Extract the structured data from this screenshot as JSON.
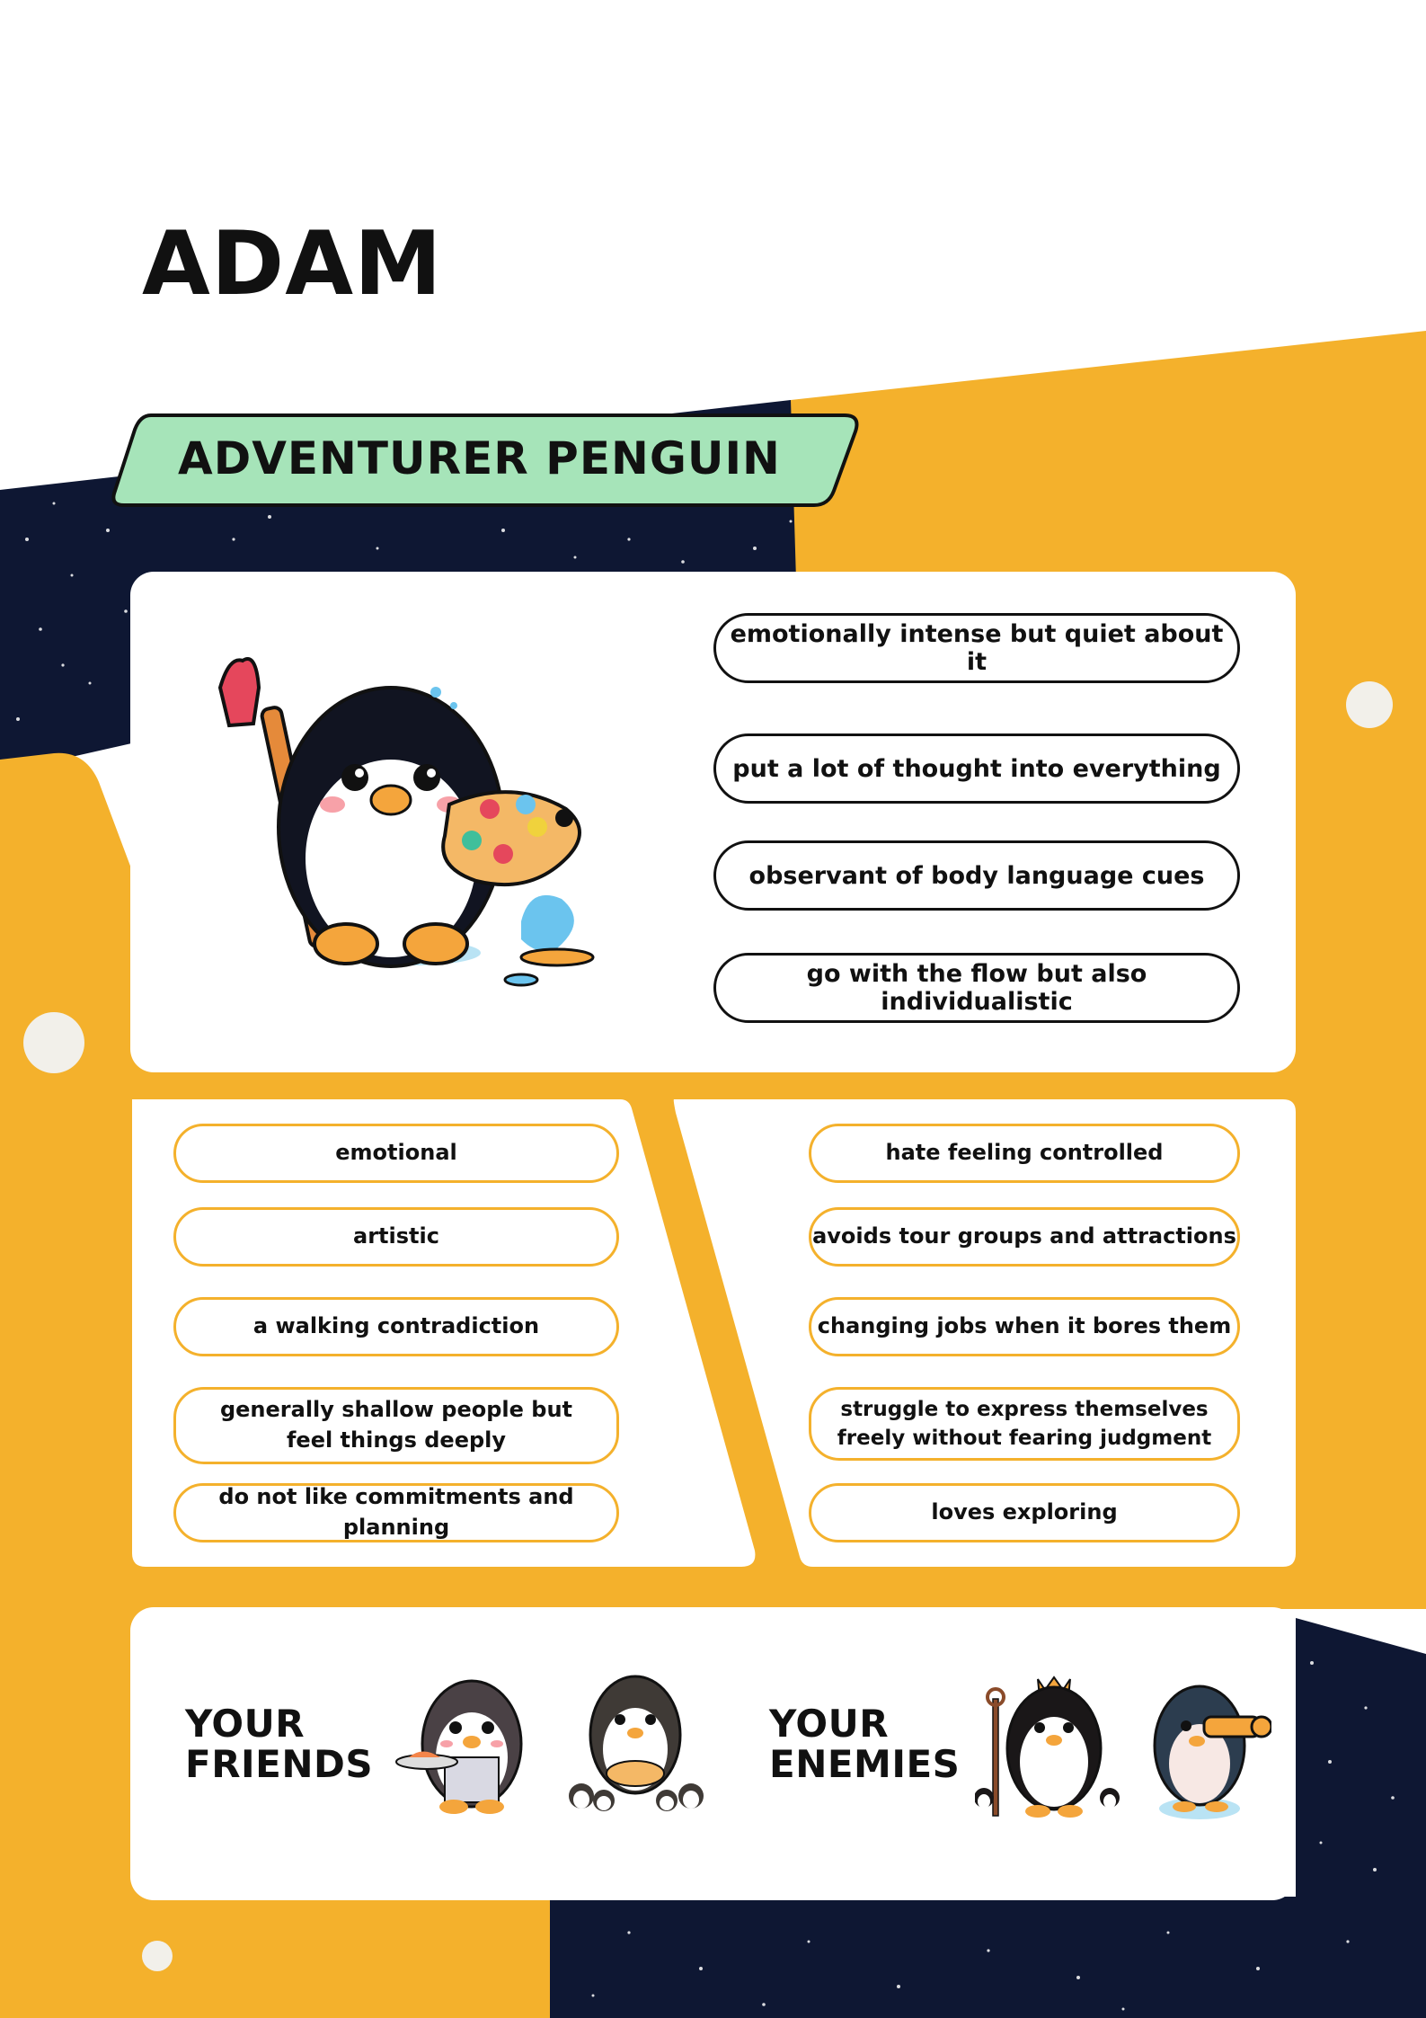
{
  "profile": {
    "name": "ADAM",
    "title": "ADVENTURER PENGUIN"
  },
  "colors": {
    "accent_yellow": "#f4b12c",
    "navy": "#0e1733",
    "banner_green": "#a6e4b9",
    "card_white": "#ffffff"
  },
  "main_traits": [
    "emotionally intense but quiet about it",
    "put a lot of thought into everything",
    "observant of body language cues",
    "go with the flow but also individualistic"
  ],
  "left_traits": [
    "emotional",
    "artistic",
    "a walking contradiction",
    "generally shallow people but feel things deeply",
    "do not like commitments and planning"
  ],
  "right_traits": [
    "hate feeling controlled",
    "avoids tour groups and attractions",
    "changing jobs when it bores them",
    "struggle to express themselves freely without fearing judgment",
    "loves exploring"
  ],
  "relations": {
    "friends_line1": "YOUR",
    "friends_line2": "FRIENDS",
    "enemies_line1": "YOUR",
    "enemies_line2": "ENEMIES"
  },
  "icons": {
    "hero": "artist-penguin-icon",
    "friend_1": "chef-penguin-icon",
    "friend_2": "baker-penguin-family-icon",
    "enemy_1": "king-penguin-icon",
    "enemy_2": "explorer-penguin-telescope-icon"
  }
}
